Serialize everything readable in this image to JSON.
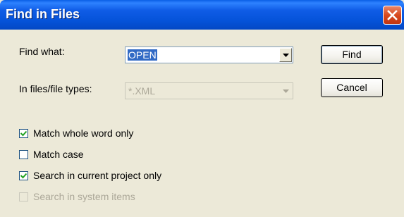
{
  "window": {
    "title": "Find in Files"
  },
  "find_what": {
    "label": "Find what:",
    "value": "OPEN"
  },
  "file_types": {
    "label": "In files/file types:",
    "value": "*.XML"
  },
  "buttons": {
    "find": "Find",
    "cancel": "Cancel"
  },
  "options": [
    {
      "label": "Match whole word only",
      "checked": true,
      "enabled": true
    },
    {
      "label": "Match case",
      "checked": false,
      "enabled": true
    },
    {
      "label": "Search in current project only",
      "checked": true,
      "enabled": true
    },
    {
      "label": "Search in system items",
      "checked": false,
      "enabled": false
    }
  ],
  "colors": {
    "title_bar": "#0553D9",
    "dialog_bg": "#ECE9D8",
    "selection": "#316AC5",
    "close": "#D8491E"
  }
}
